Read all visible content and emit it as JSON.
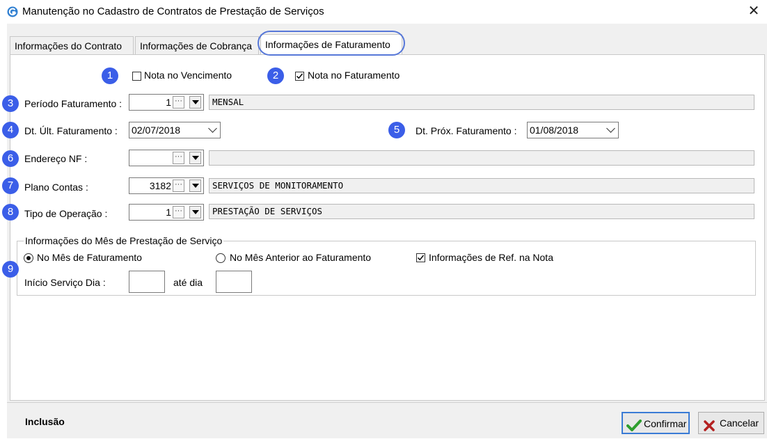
{
  "window": {
    "title": "Manutenção no Cadastro de Contratos de Prestação de Serviços",
    "close_glyph": "✕"
  },
  "tabs": [
    {
      "label": "Informações do Contrato",
      "active": false
    },
    {
      "label": "Informações de Cobrança",
      "active": false
    },
    {
      "label": "Informações de Faturamento",
      "active": true
    }
  ],
  "badges": [
    "1",
    "2",
    "3",
    "4",
    "5",
    "6",
    "7",
    "8",
    "9"
  ],
  "badge_color": "#3b5ee8",
  "highlight_ring_color": "#5677d8",
  "flags": {
    "nota_vencimento": {
      "label": "Nota no Vencimento",
      "checked": false
    },
    "nota_faturamento": {
      "label": "Nota no Faturamento",
      "checked": true
    }
  },
  "fields": {
    "periodo": {
      "label": "Período Faturamento :",
      "code": "1",
      "description": "MENSAL"
    },
    "dt_ult": {
      "label": "Dt. Últ. Faturamento :",
      "value": "02/07/2018"
    },
    "dt_prox": {
      "label": "Dt. Próx. Faturamento :",
      "value": "01/08/2018"
    },
    "endereco": {
      "label": "Endereço NF :",
      "code": "",
      "description": ""
    },
    "plano": {
      "label": "Plano Contas :",
      "code": "3182",
      "description": "SERVIÇOS DE MONITORAMENTO"
    },
    "tipo": {
      "label": "Tipo de Operação :",
      "code": "1",
      "description": "PRESTAÇÃO DE SERVIÇOS"
    }
  },
  "lookup_glyph": "···",
  "group": {
    "title": "Informações do Mês de Prestação de Serviço",
    "radio_options": [
      {
        "label": "No Mês de Faturamento",
        "selected": true
      },
      {
        "label": "No Mês Anterior ao Faturamento",
        "selected": false
      }
    ],
    "ref_nota": {
      "label": "Informações de Ref. na Nota",
      "checked": true
    },
    "inicio_label": "Início Serviço Dia :",
    "ate_label": "até dia",
    "inicio_value": "",
    "ate_value": ""
  },
  "status": {
    "mode": "Inclusão"
  },
  "buttons": {
    "confirm": {
      "label": "Confirmar",
      "icon": "check-icon",
      "color": "#2e9e2e"
    },
    "cancel": {
      "label": "Cancelar",
      "icon": "x-icon",
      "color": "#b32020"
    }
  }
}
